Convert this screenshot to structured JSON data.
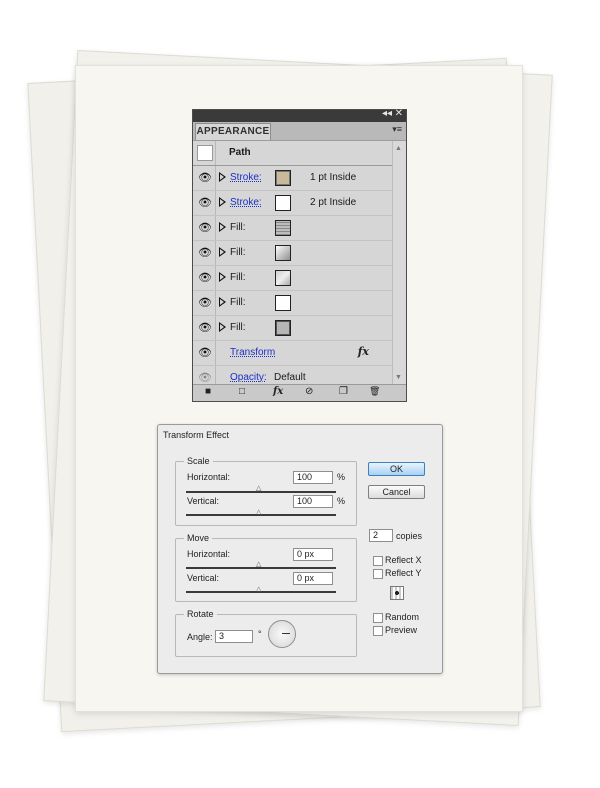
{
  "appearance_panel": {
    "tab_label": "APPEARANCE",
    "collapse_glyph": "◂◂",
    "close_glyph": "✕",
    "menu_glyph": "▾≡",
    "header": {
      "title": "Path"
    },
    "rows": [
      {
        "label": "Stroke:",
        "value": "1 pt  Inside",
        "swatch": "tan"
      },
      {
        "label": "Stroke:",
        "value": "2 pt  Inside",
        "swatch": "white"
      },
      {
        "label": "Fill:",
        "value": "",
        "swatch": "striped"
      },
      {
        "label": "Fill:",
        "value": "",
        "swatch": "gradient-light"
      },
      {
        "label": "Fill:",
        "value": "",
        "swatch": "gradient-mid"
      },
      {
        "label": "Fill:",
        "value": "",
        "swatch": "white"
      },
      {
        "label": "Fill:",
        "value": "",
        "swatch": "gray"
      }
    ],
    "transform_label": "Transform",
    "fx_glyph": "fx",
    "opacity_label": "Opacity:",
    "opacity_value": "Default",
    "bottom_glyphs": {
      "add_stroke": "■",
      "add_fill": "□",
      "fx_menu": "fx",
      "clear": "⊘",
      "duplicate": "❐",
      "delete": "🗑"
    },
    "icons": [
      "visibility-eye-icon",
      "expand-triangle-icon",
      "fx-icon",
      "trash-icon"
    ]
  },
  "transform_dialog": {
    "title": "Transform Effect",
    "scale": {
      "group_label": "Scale",
      "horizontal_label": "Horizontal:",
      "horizontal_value": "100",
      "vertical_label": "Vertical:",
      "vertical_value": "100",
      "unit": "%"
    },
    "move": {
      "group_label": "Move",
      "horizontal_label": "Horizontal:",
      "horizontal_value": "0 px",
      "vertical_label": "Vertical:",
      "vertical_value": "0 px"
    },
    "rotate": {
      "group_label": "Rotate",
      "angle_label": "Angle:",
      "angle_value": "3",
      "degree_symbol": "°"
    },
    "ok_label": "OK",
    "cancel_label": "Cancel",
    "copies_value": "2",
    "copies_label": "copies",
    "reflect_x_label": "Reflect X",
    "reflect_y_label": "Reflect Y",
    "random_label": "Random",
    "preview_label": "Preview",
    "checkboxes": {
      "reflect_x": false,
      "reflect_y": false,
      "random": false,
      "preview": false
    }
  }
}
